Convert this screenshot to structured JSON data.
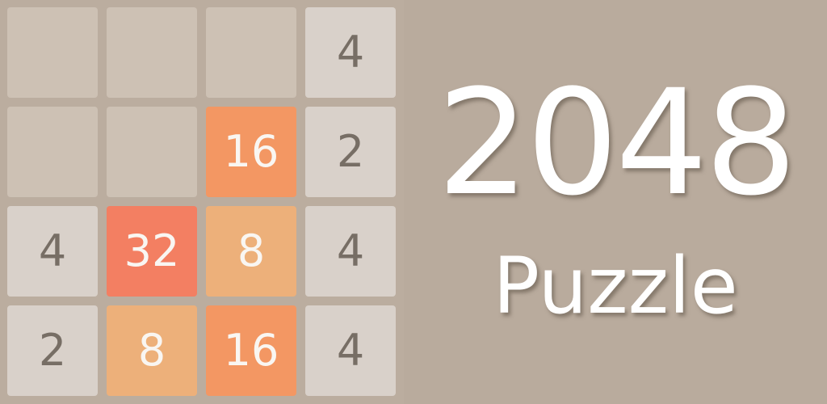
{
  "game": {
    "title": "2048",
    "subtitle": "Puzzle",
    "board": [
      [
        "",
        "",
        "",
        "4"
      ],
      [
        "",
        "",
        "16",
        "2"
      ],
      [
        "4",
        "32",
        "8",
        "4"
      ],
      [
        "2",
        "8",
        "16",
        "4"
      ]
    ]
  },
  "colors": {
    "background": "#b9ab9d",
    "board": "#bbad9f",
    "empty_tile": "#cdc1b4",
    "tile_2_4": "#d9d1ca",
    "tile_8": "#edb07a",
    "tile_16": "#f39763",
    "tile_32": "#f37f62",
    "dark_text": "#776e65",
    "light_text": "#f9f6f2"
  }
}
